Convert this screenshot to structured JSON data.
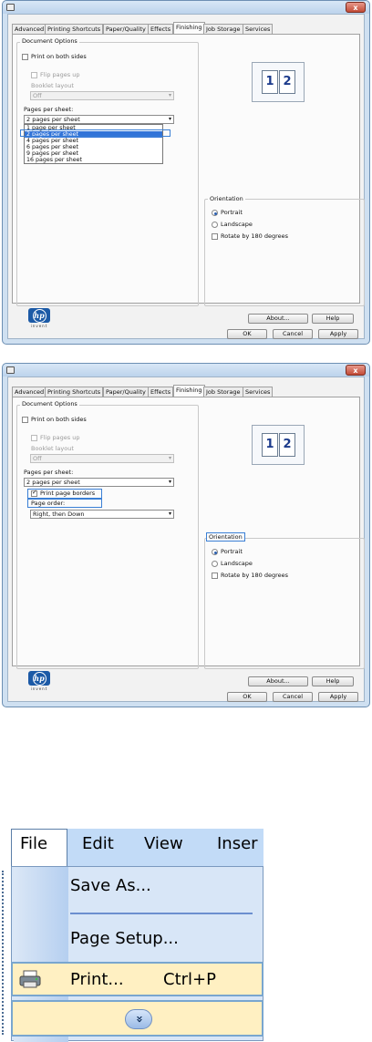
{
  "dialog_tabs": [
    "Advanced",
    "Printing Shortcuts",
    "Paper/Quality",
    "Effects",
    "Finishing",
    "Job Storage",
    "Services"
  ],
  "active_tab": "Finishing",
  "close_symbol": "x",
  "document_options": {
    "legend": "Document Options",
    "print_both_sides": "Print on both sides",
    "flip_pages_up": "Flip pages up",
    "booklet_layout": "Booklet layout",
    "booklet_value": "Off",
    "pages_per_sheet_label": "Pages per sheet:",
    "pages_per_sheet_value": "2 pages per sheet",
    "pages_per_sheet_options": [
      "1 page per sheet",
      "2 pages per sheet",
      "4 pages per sheet",
      "6 pages per sheet",
      "9 pages per sheet",
      "16 pages per sheet"
    ],
    "print_page_borders": "Print page borders",
    "page_order_label": "Page order:",
    "page_order_value": "Right, then Down"
  },
  "preview_pages": [
    "1",
    "2"
  ],
  "orientation": {
    "legend": "Orientation",
    "portrait": "Portrait",
    "landscape": "Landscape",
    "rotate": "Rotate by 180 degrees"
  },
  "buttons": {
    "about": "About...",
    "help": "Help",
    "ok": "OK",
    "cancel": "Cancel",
    "apply": "Apply"
  },
  "brand": {
    "logo_text": "hp",
    "tagline": "invent",
    "color": "#1c5aa6"
  },
  "office_menu": {
    "menubar": [
      "File",
      "Edit",
      "View",
      "Inser"
    ],
    "items": {
      "save_as": "Save As...",
      "page_setup": "Page Setup...",
      "print": "Print...",
      "print_shortcut": "Ctrl+P",
      "expand": "»"
    }
  },
  "icons": [
    "close-icon",
    "printer-icon",
    "chevron-down-icon",
    "radio-icon",
    "checkbox-icon"
  ]
}
